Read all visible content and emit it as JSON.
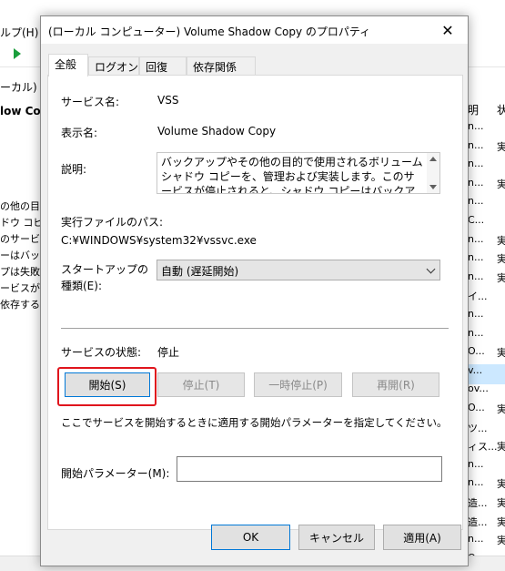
{
  "background": {
    "menu_help": "ルプ(H)",
    "tree_local": "ーカル)",
    "header_label": "low Cop",
    "desc_lines": [
      "の他の目",
      "ドウ コピ",
      "のサービ",
      "ーはバック",
      "プは失敗",
      "ービスが多",
      "依存する"
    ],
    "columns": [
      "明",
      "状"
    ],
    "rows": [
      [
        "n...",
        ""
      ],
      [
        "n...",
        "実"
      ],
      [
        "n...",
        ""
      ],
      [
        "n...",
        "実"
      ],
      [
        "n...",
        ""
      ],
      [
        "C...",
        ""
      ],
      [
        "n...",
        "実"
      ],
      [
        "n...",
        "実"
      ],
      [
        "n...",
        "実"
      ],
      [
        "イ...",
        ""
      ],
      [
        "n...",
        ""
      ],
      [
        "n...",
        ""
      ],
      [
        "O...",
        "実"
      ],
      [
        "v...",
        ""
      ],
      [
        "ov...",
        ""
      ],
      [
        "O...",
        "実"
      ],
      [
        "ツ...",
        ""
      ],
      [
        "ィス...",
        "実"
      ],
      [
        "n...",
        ""
      ],
      [
        "n...",
        "実"
      ],
      [
        "造...",
        "実"
      ],
      [
        "造...",
        "実"
      ],
      [
        "n...",
        "実"
      ],
      [
        "O...",
        ""
      ],
      [
        "n...",
        ""
      ]
    ]
  },
  "dialog": {
    "title": "(ローカル コンピューター) Volume Shadow Copy のプロパティ",
    "close_glyph": "✕",
    "tabs": [
      {
        "label": "全般"
      },
      {
        "label": "ログオン"
      },
      {
        "label": "回復"
      },
      {
        "label": "依存関係"
      }
    ],
    "service_name_label": "サービス名:",
    "service_name_value": "VSS",
    "display_name_label": "表示名:",
    "display_name_value": "Volume Shadow Copy",
    "description_label": "説明:",
    "description_value": "バックアップやその他の目的で使用されるボリューム シャドウ コピーを、管理および実装します。このサービスが停止されると、シャドウ コピーはバックアップに利用できず、バック",
    "exe_path_label": "実行ファイルのパス:",
    "exe_path_value": "C:¥WINDOWS¥system32¥vssvc.exe",
    "startup_type_label_line1": "スタートアップの",
    "startup_type_label_line2": "種類(E):",
    "startup_type_value": "自動 (遅延開始)",
    "service_status_label": "サービスの状態:",
    "service_status_value": "停止",
    "buttons": {
      "start": "開始(S)",
      "stop": "停止(T)",
      "pause": "一時停止(P)",
      "resume": "再開(R)"
    },
    "hint_text": "ここでサービスを開始するときに適用する開始パラメーターを指定してください。",
    "start_params_label": "開始パラメーター(M):",
    "start_params_value": "",
    "footer": {
      "ok": "OK",
      "cancel": "キャンセル",
      "apply": "適用(A)"
    },
    "colors": {
      "highlight": "#e0151d",
      "focus_blue": "#0078d7"
    }
  }
}
